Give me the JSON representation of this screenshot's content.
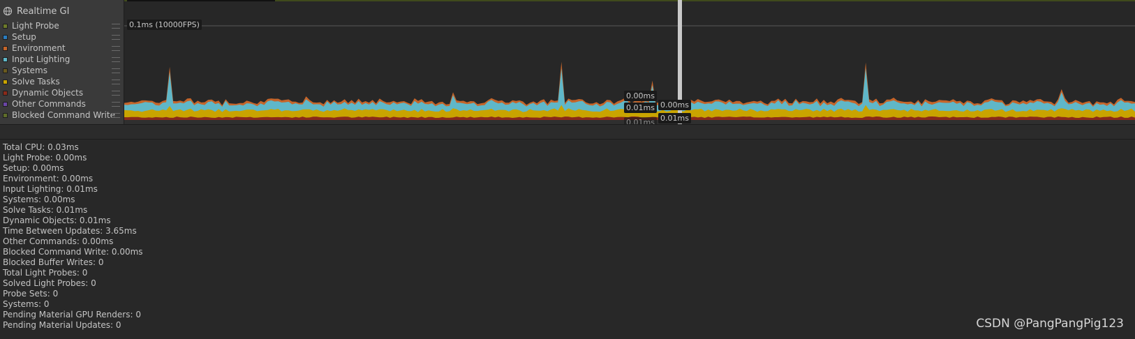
{
  "module": {
    "title": "Realtime GI",
    "icon": "globe-icon"
  },
  "legend": [
    {
      "label": "Light Probe",
      "color": "#6c7a2a"
    },
    {
      "label": "Setup",
      "color": "#2a7cbf"
    },
    {
      "label": "Environment",
      "color": "#c5652a"
    },
    {
      "label": "Input Lighting",
      "color": "#5fb7c8"
    },
    {
      "label": "Systems",
      "color": "#6a5a1e"
    },
    {
      "label": "Solve Tasks",
      "color": "#c9a400"
    },
    {
      "label": "Dynamic Objects",
      "color": "#8a2a1a"
    },
    {
      "label": "Other Commands",
      "color": "#6b46a6"
    },
    {
      "label": "Blocked Command Write",
      "color": "#5e6d2a"
    }
  ],
  "chart": {
    "scale_label": "0.1ms (10000FPS)",
    "tooltips_left": [
      "0.00ms",
      "0.01ms",
      "0.01ms"
    ],
    "tooltips_right": [
      "0.00ms",
      "0.01ms"
    ]
  },
  "stats": [
    "Total CPU: 0.03ms",
    "Light Probe: 0.00ms",
    "Setup: 0.00ms",
    "Environment: 0.00ms",
    "Input Lighting: 0.01ms",
    "Systems: 0.00ms",
    "Solve Tasks: 0.01ms",
    "Dynamic Objects: 0.01ms",
    "Time Between Updates: 3.65ms",
    "Other Commands: 0.00ms",
    "Blocked Command Write: 0.00ms",
    "Blocked Buffer Writes: 0",
    "Total Light Probes: 0",
    "Solved Light Probes: 0",
    "Probe Sets: 0",
    "Systems: 0",
    "Pending Material GPU Renders: 0",
    "Pending Material Updates: 0"
  ],
  "watermark": "CSDN @PangPangPig123"
}
